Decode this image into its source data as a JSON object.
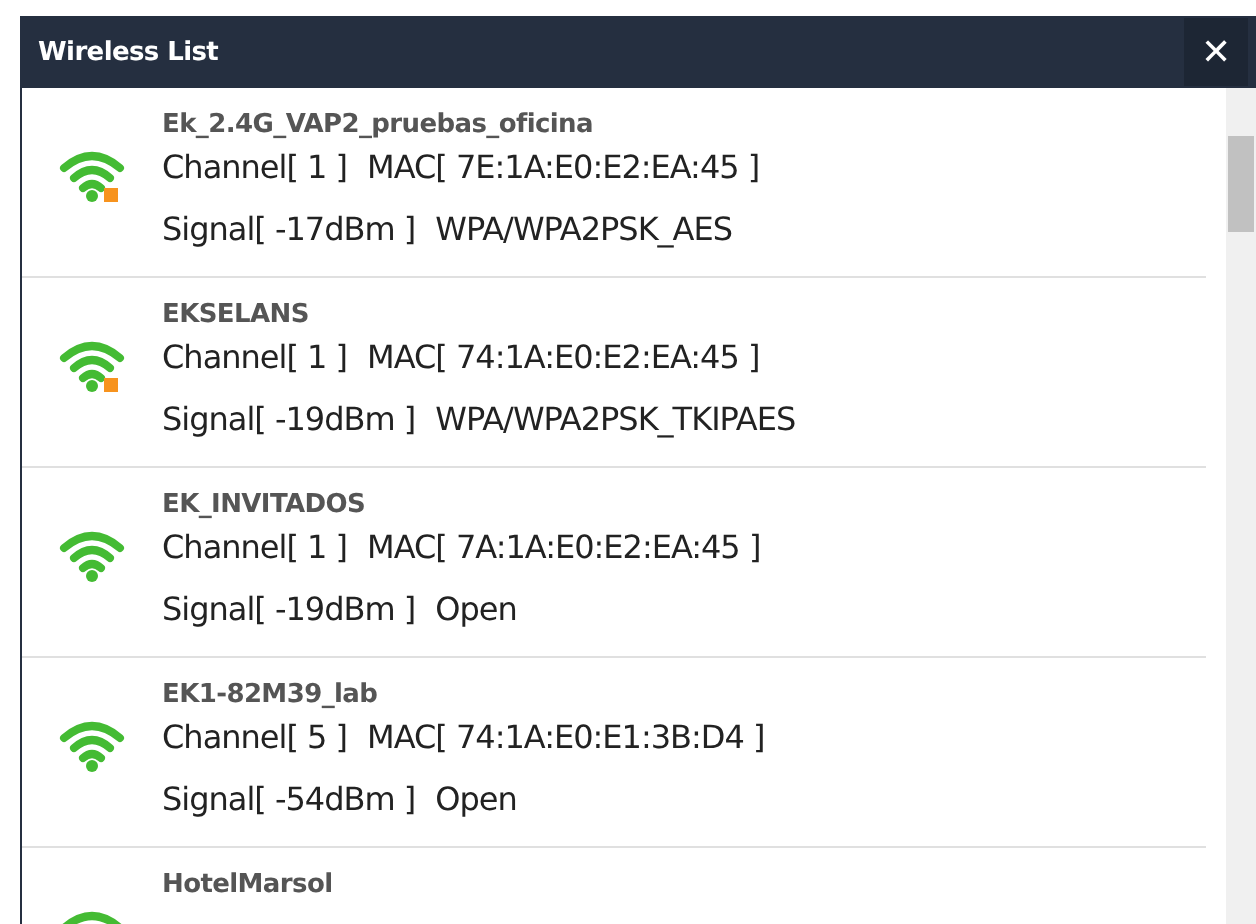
{
  "window": {
    "title": "Wireless List",
    "close": "✕"
  },
  "networks": [
    {
      "name": "Ek_2.4G_VAP2_pruebas_oficina",
      "channel": "Channel[ 1 ]",
      "mac": "MAC[ 7E:1A:E0:E2:EA:45 ]",
      "signal": "Signal[ -17dBm ]",
      "security": "WPA/WPA2PSK_AES",
      "locked": true
    },
    {
      "name": "EKSELANS",
      "channel": "Channel[ 1 ]",
      "mac": "MAC[ 74:1A:E0:E2:EA:45 ]",
      "signal": "Signal[ -19dBm ]",
      "security": "WPA/WPA2PSK_TKIPAES",
      "locked": true
    },
    {
      "name": "EK_INVITADOS",
      "channel": "Channel[ 1 ]",
      "mac": "MAC[ 7A:1A:E0:E2:EA:45 ]",
      "signal": "Signal[ -19dBm ]",
      "security": "Open",
      "locked": false
    },
    {
      "name": "EK1-82M39_lab",
      "channel": "Channel[ 5 ]",
      "mac": "MAC[ 74:1A:E0:E1:3B:D4 ]",
      "signal": "Signal[ -54dBm ]",
      "security": "Open",
      "locked": false
    },
    {
      "name": "HotelMarsol"
    }
  ]
}
